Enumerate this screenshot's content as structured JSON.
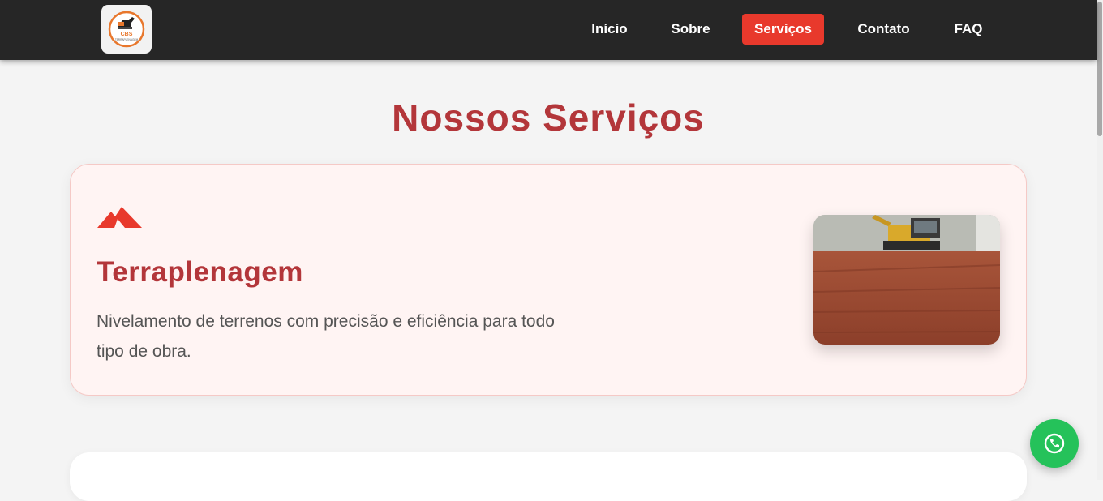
{
  "header": {
    "logo": {
      "text": "CBS",
      "subtext": "TERRAPLENAGEM",
      "icon": "excavator-logo"
    },
    "nav": [
      {
        "label": "Início",
        "active": false
      },
      {
        "label": "Sobre",
        "active": false
      },
      {
        "label": "Serviços",
        "active": true
      },
      {
        "label": "Contato",
        "active": false
      },
      {
        "label": "FAQ",
        "active": false
      }
    ]
  },
  "main": {
    "title": "Nossos Serviços",
    "services": [
      {
        "icon": "mountain-icon",
        "title": "Terraplenagem",
        "description": "Nivelamento de terrenos com precisão e eficiência para todo tipo de obra.",
        "image": "excavator-on-dirt-photo"
      }
    ]
  },
  "floating": {
    "icon": "whatsapp-phone-icon"
  },
  "colors": {
    "header_bg": "#262626",
    "accent": "#e8392c",
    "title": "#b3363a",
    "card_bg": "#fff4f3",
    "whatsapp": "#25c25a"
  }
}
